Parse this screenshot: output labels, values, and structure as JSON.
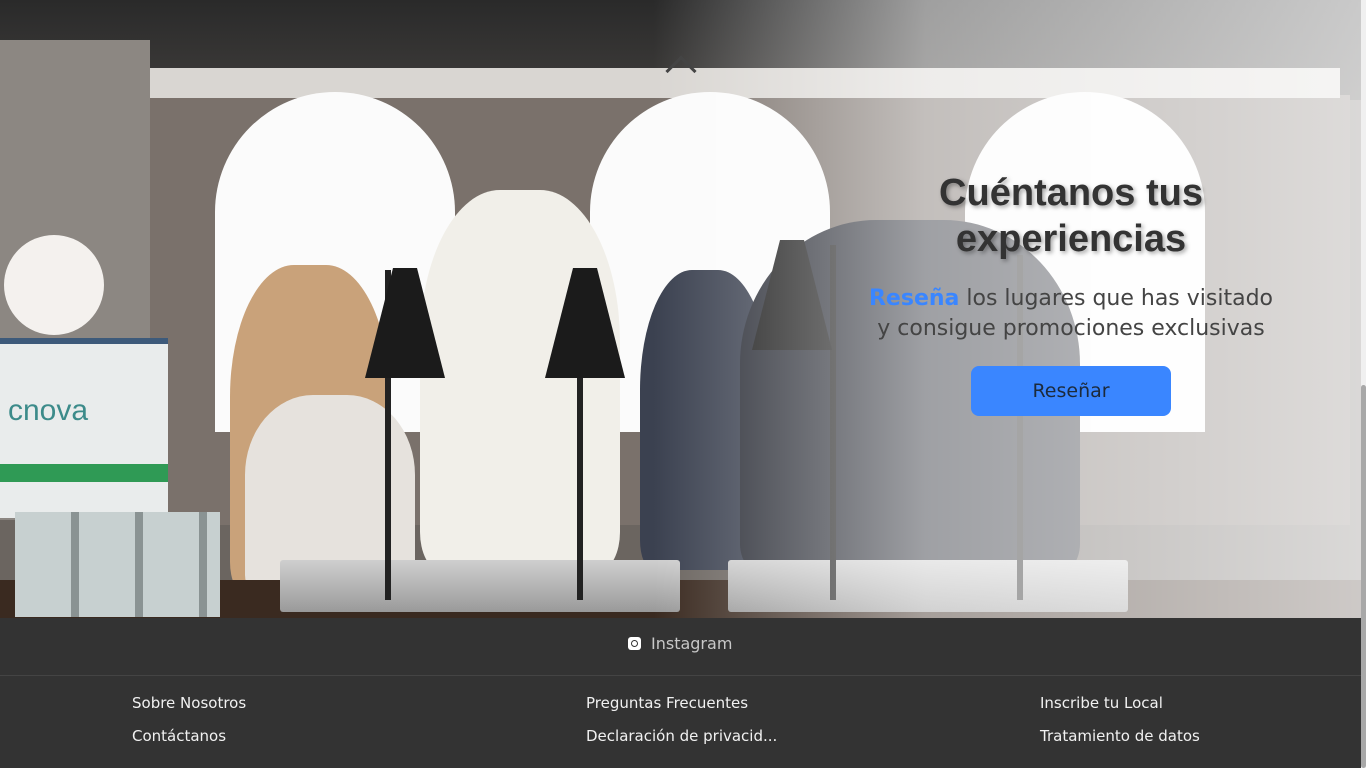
{
  "hero": {
    "title": "Cuéntanos tus experiencias",
    "subtitle_highlight": "Reseña",
    "subtitle_rest": " los lugares que has visitado y consigue promociones exclusivas",
    "button_label": "Reseñar",
    "banner_text": "cnova",
    "colors": {
      "accent": "#3a86ff",
      "title": "#333333"
    }
  },
  "footer": {
    "social": {
      "label": "Instagram",
      "icon": "instagram-icon"
    },
    "columns": [
      {
        "top": "Sobre Nosotros",
        "bottom": "Contáctanos"
      },
      {
        "top": "Preguntas Frecuentes",
        "bottom": "Declaración de privacid..."
      },
      {
        "top": "Inscribe tu Local",
        "bottom": "Tratamiento de datos"
      }
    ],
    "background": "#333333"
  }
}
